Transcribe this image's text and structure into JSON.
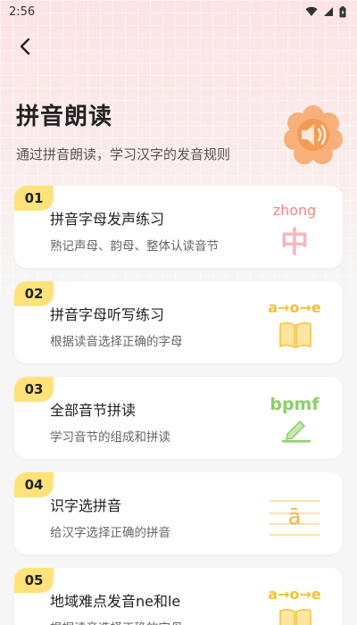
{
  "status": {
    "time": "2:56"
  },
  "header": {
    "title": "拼音朗读",
    "subtitle": "通过拼音朗读，学习汉字的发音规则"
  },
  "cards": [
    {
      "number": "01",
      "title": "拼音字母发声练习",
      "desc": "熟记声母、韵母、整体认读音节",
      "art_text": "zhong",
      "art_char": "中",
      "art_icon": "zhong-character-icon"
    },
    {
      "number": "02",
      "title": "拼音字母听写练习",
      "desc": "根据读音选择正确的字母",
      "art_text": "a→o→e",
      "art_icon": "vowels-book-icon"
    },
    {
      "number": "03",
      "title": "全部音节拼读",
      "desc": "学习音节的组成和拼读",
      "art_text": "bpmf",
      "art_icon": "bpmf-pencil-icon"
    },
    {
      "number": "04",
      "title": "识字选拼音",
      "desc": "给汉字选择正确的拼音",
      "art_text": "ā",
      "art_icon": "tone-lines-icon"
    },
    {
      "number": "05",
      "title": "地域难点发音ne和le",
      "desc": "根据读音选择正确的字母",
      "art_text": "a→o→e",
      "art_icon": "vowels-book-icon"
    }
  ],
  "colors": {
    "accent_yellow": "#ffe27a",
    "orange": "#f7a35c",
    "pink": "#f08a8a",
    "green": "#8ccf6a",
    "hero_bg": "#fde3e3"
  }
}
